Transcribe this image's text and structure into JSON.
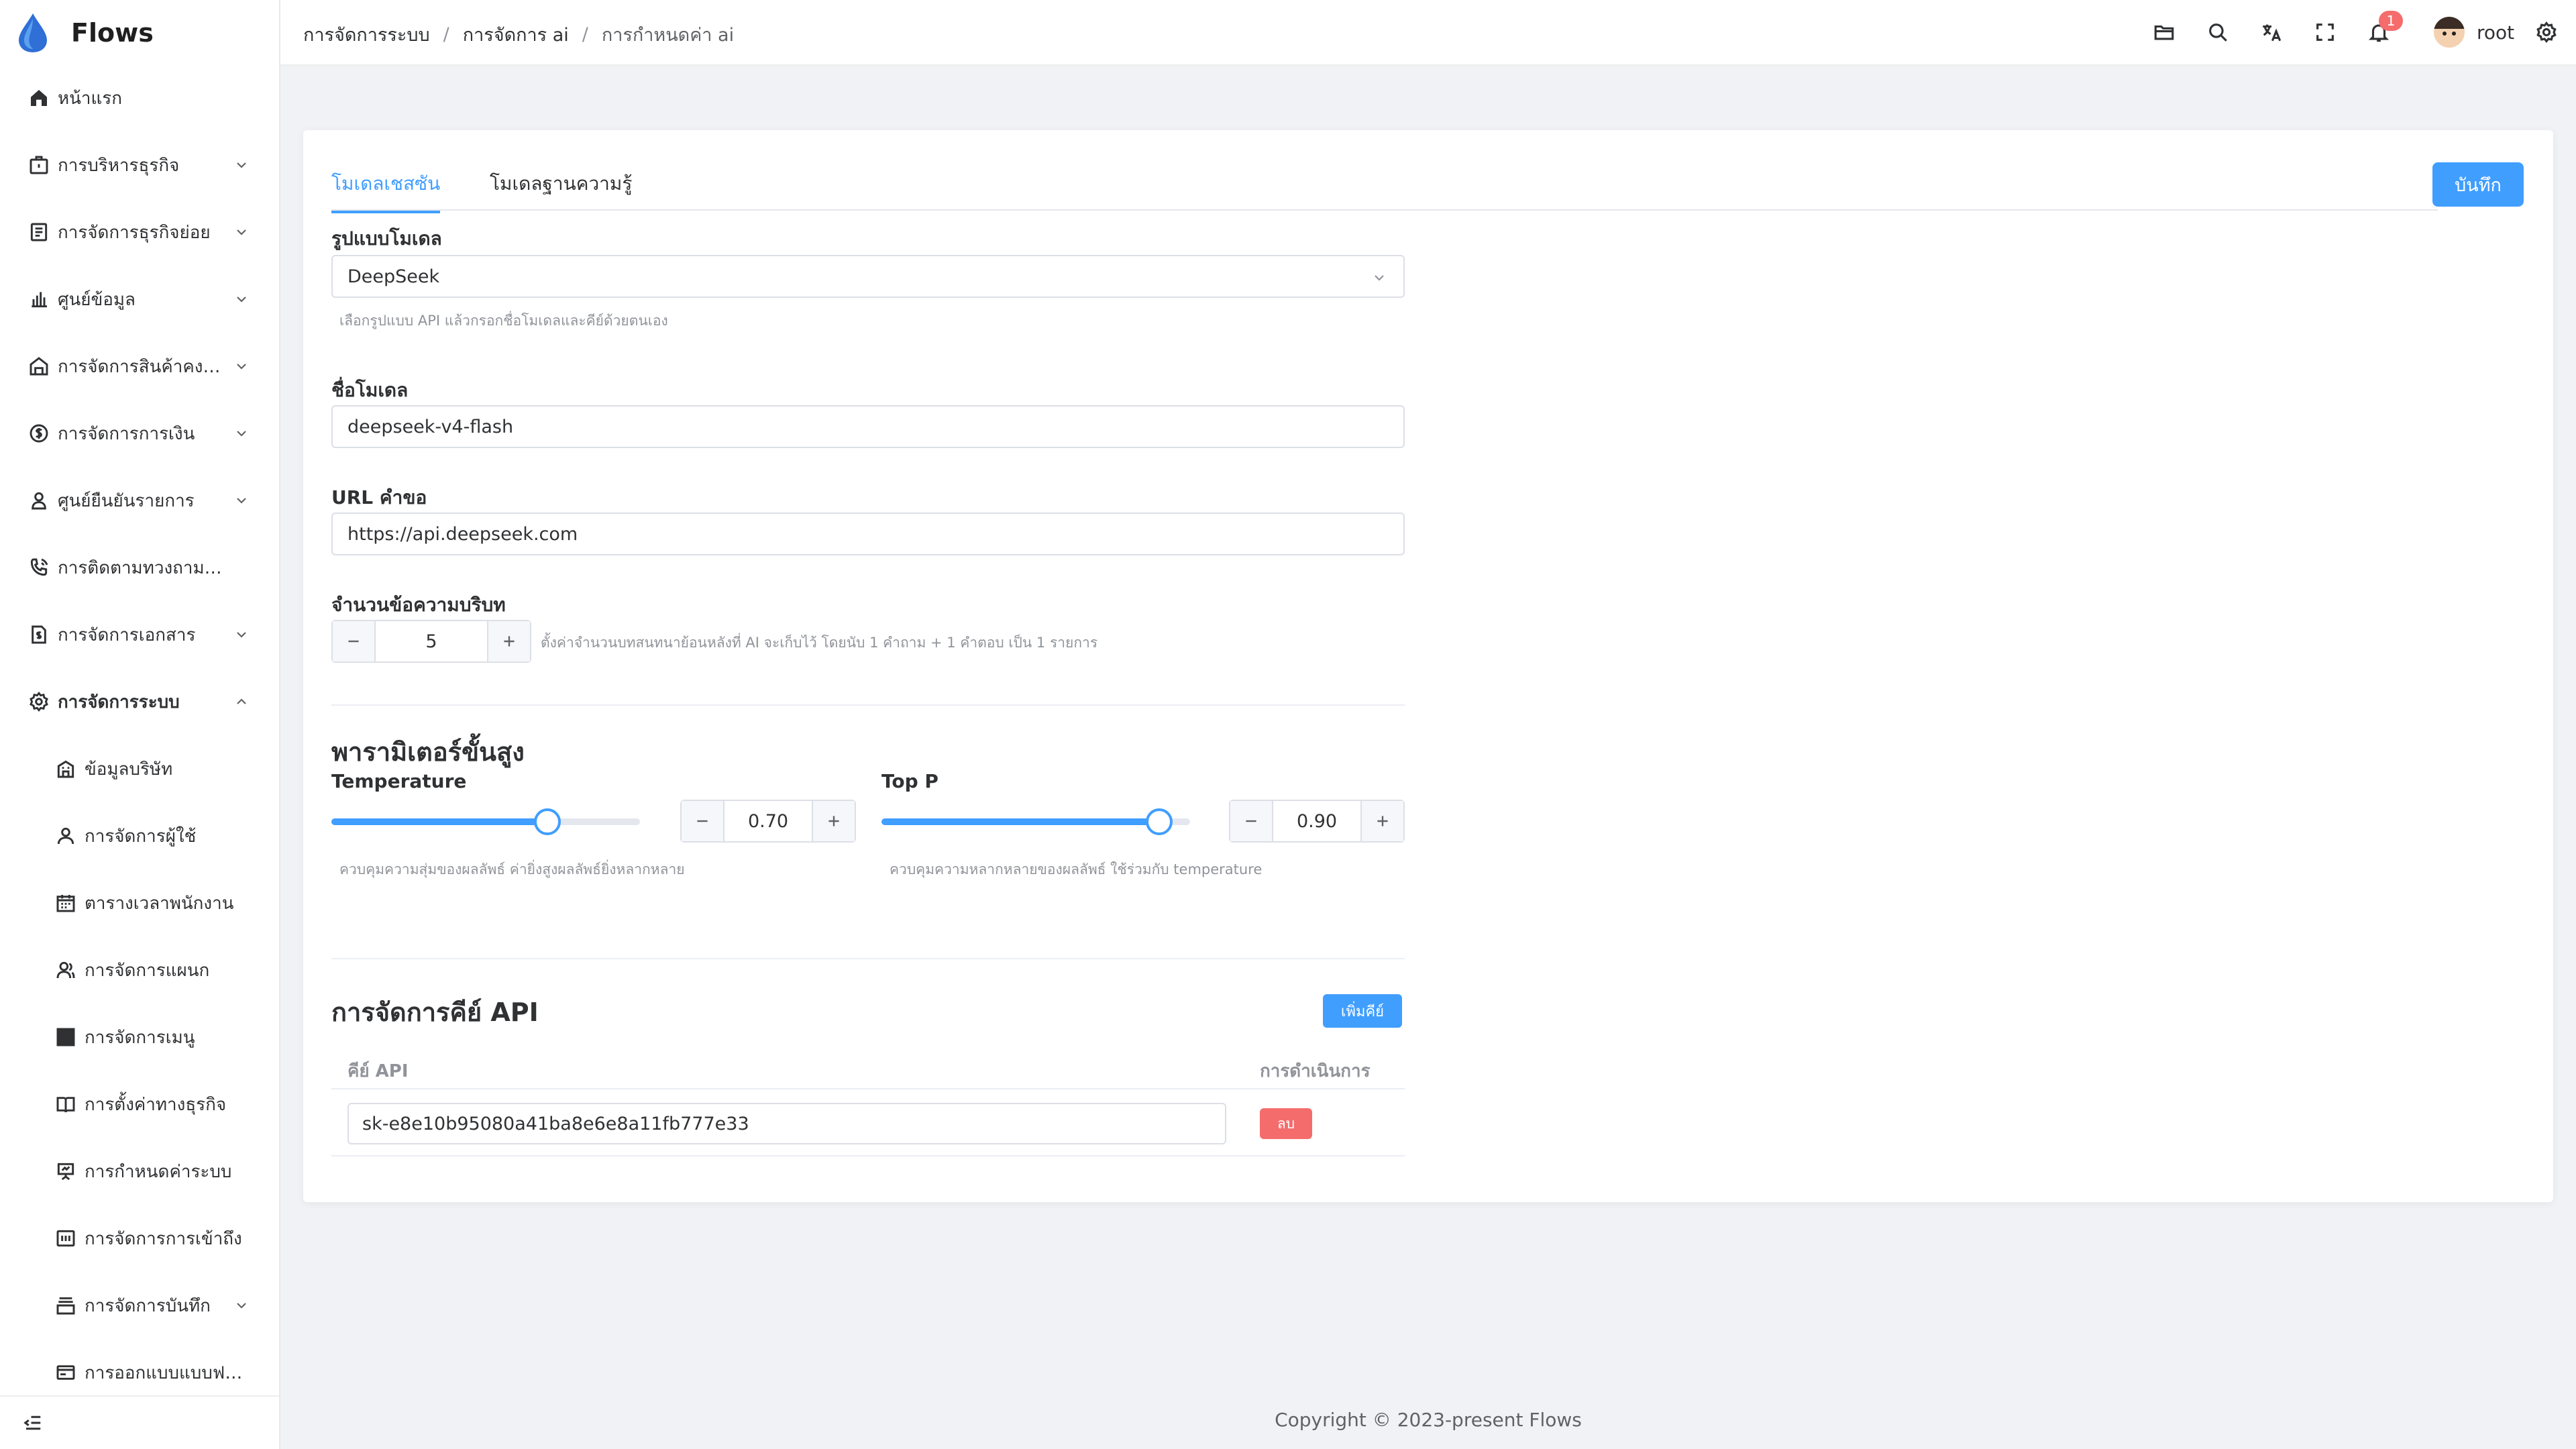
{
  "app": {
    "name": "Flows"
  },
  "sidebar": {
    "items": [
      {
        "label": "หน้าแรก",
        "icon": "home-icon"
      },
      {
        "label": "การบริหารธุรกิจ",
        "icon": "briefcase-icon"
      },
      {
        "label": "การจัดการธุรกิจย่อย",
        "icon": "document-list-icon"
      },
      {
        "label": "ศูนย์ข้อมูล",
        "icon": "bar-chart-icon"
      },
      {
        "label": "การจัดการสินค้าคงคลัง",
        "icon": "warehouse-icon"
      },
      {
        "label": "การจัดการการเงิน",
        "icon": "dollar-circle-icon"
      },
      {
        "label": "ศูนย์ยืนยันรายการ",
        "icon": "user-check-icon"
      },
      {
        "label": "การติดตามทวงถามหนี้",
        "icon": "phone-call-icon"
      },
      {
        "label": "การจัดการเอกสาร",
        "icon": "invoice-icon"
      },
      {
        "label": "การจัดการระบบ",
        "icon": "gear-icon"
      }
    ],
    "sub_items": [
      {
        "label": "ข้อมูลบริษัท",
        "icon": "company-icon"
      },
      {
        "label": "การจัดการผู้ใช้",
        "icon": "user-icon"
      },
      {
        "label": "ตารางเวลาพนักงาน",
        "icon": "calendar-icon"
      },
      {
        "label": "การจัดการแผนก",
        "icon": "team-icon"
      },
      {
        "label": "การจัดการเมนู",
        "icon": "grid-icon"
      },
      {
        "label": "การตั้งค่าทางธุรกิจ",
        "icon": "book-icon"
      },
      {
        "label": "การกำหนดค่าระบบ",
        "icon": "presentation-icon"
      },
      {
        "label": "การจัดการการเข้าถึง",
        "icon": "access-icon"
      },
      {
        "label": "การจัดการบันทึก",
        "icon": "archive-icon"
      },
      {
        "label": "การออกแบบแบบฟอร์ม",
        "icon": "form-icon"
      }
    ]
  },
  "header": {
    "breadcrumb": [
      "การจัดการระบบ",
      "การจัดการ ai",
      "การกำหนดค่า ai"
    ],
    "separator": "/",
    "notification_count": "1",
    "user_name": "root"
  },
  "tabs": [
    "โมเดลเชสซัน",
    "โมเดลฐานความรู้"
  ],
  "save_label": "บันทึก",
  "form": {
    "model_type_label": "รูปแบบโมเดล",
    "model_type_value": "DeepSeek",
    "model_type_help": "เลือกรูปแบบ API แล้วกรอกชื่อโมเดลและคีย์ด้วยตนเอง",
    "model_name_label": "ชื่อโมเดล",
    "model_name_value": "deepseek-v4-flash",
    "url_label": "URL คำขอ",
    "url_value": "https://api.deepseek.com",
    "context_label": "จำนวนข้อความบริบท",
    "context_value": "5",
    "context_help": "ตั้งค่าจำนวนบทสนทนาย้อนหลังที่ AI จะเก็บไว้ โดยนับ 1 คำถาม + 1 คำตอบ เป็น 1 รายการ"
  },
  "advanced": {
    "title": "พารามิเตอร์ขั้นสูง",
    "temperature": {
      "label": "Temperature",
      "value": "0.70",
      "fraction": 0.7,
      "help": "ควบคุมความสุ่มของผลลัพธ์ ค่ายิ่งสูงผลลัพธ์ยิ่งหลากหลาย"
    },
    "top_p": {
      "label": "Top P",
      "value": "0.90",
      "fraction": 0.9,
      "help": "ควบคุมความหลากหลายของผลลัพธ์ ใช้ร่วมกับ temperature"
    }
  },
  "api_keys": {
    "title": "การจัดการคีย์ API",
    "add_label": "เพิ่มคีย์",
    "col_key": "คีย์ API",
    "col_action": "การดำเนินการ",
    "rows": [
      {
        "key": "sk-e8e10b95080a41ba8e6e8a11fb777e33",
        "delete_label": "ลบ"
      }
    ]
  },
  "footer": {
    "text": "Copyright © 2023-present Flows"
  },
  "colors": {
    "primary": "#409eff",
    "danger": "#f56c6c",
    "background": "#f0f2f5"
  }
}
